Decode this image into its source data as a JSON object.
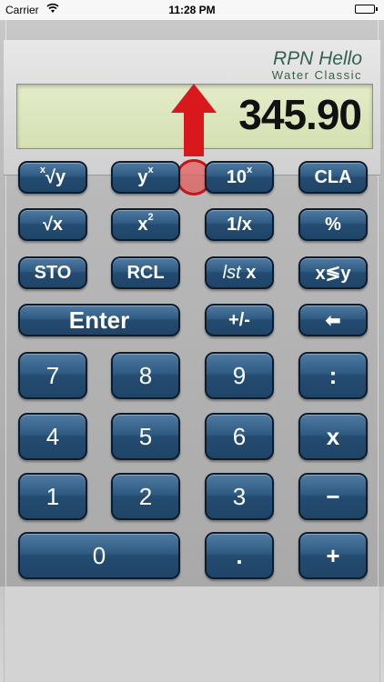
{
  "status_bar": {
    "carrier": "Carrier",
    "time": "11:28 PM"
  },
  "brand": {
    "title": "RPN Hello",
    "subtitle": "Water Classic"
  },
  "display": {
    "value": "345.90"
  },
  "annotation": {
    "arrow_color": "#d9181d",
    "circle_color": "#c2161b"
  },
  "keys": {
    "root_y_x": {
      "sup": "x",
      "main": "√y"
    },
    "y_pow_x": {
      "main": "y",
      "sup": "x"
    },
    "ten_pow_x": {
      "main": "10",
      "sup": "x"
    },
    "cla": "CLA",
    "sqrt_x": "√x",
    "x_squared": {
      "main": "x",
      "sup": "2"
    },
    "reciprocal": "1/x",
    "percent": "%",
    "sto": "STO",
    "rcl": "RCL",
    "last_x": {
      "italic": "lst",
      "main": " x"
    },
    "swap": "x≶y",
    "enter": "Enter",
    "change_sign": "+/-",
    "backspace": "⬅",
    "d7": "7",
    "d8": "8",
    "d9": "9",
    "divide": ":",
    "d4": "4",
    "d5": "5",
    "d6": "6",
    "multiply": "x",
    "d1": "1",
    "d2": "2",
    "d3": "3",
    "minus": "−",
    "d0": "0",
    "decimal": ".",
    "plus": "+"
  },
  "colors": {
    "key_blue": "#2f5b83",
    "lcd_green": "#dde7bd",
    "brand_green": "#35604f"
  }
}
